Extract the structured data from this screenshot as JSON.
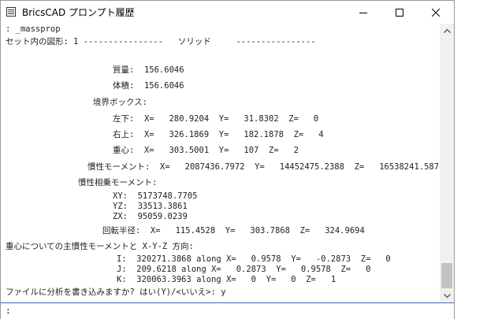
{
  "window": {
    "title": "BricsCAD プロンプト履歴"
  },
  "lines": [
    ": _massprop",
    "セット内の図形: 1 ----------------   ソリッド     ----------------",
    "質量:  156.6046",
    "体積:  156.6046",
    "境界ボックス:",
    "左下:  X=   280.9204  Y=   31.8302  Z=   0",
    "右上:  X=   326.1869  Y=   182.1878  Z=   4",
    "重心:  X=   303.5001  Y=   107  Z=   2",
    "慣性モーメント:  X=   2087436.7972  Y=   14452475.2388  Z=   16538241.587",
    "慣性相乗モーメント:",
    "XY:  5173748.7705",
    "YZ:  33513.3861",
    "ZX:  95059.0239",
    "回転半径:  X=   115.4528  Y=   303.7868  Z=   324.9694",
    "重心についての主慣性モーメントと X-Y-Z 方向:",
    "I:  320271.3868 along X=   0.9578  Y=   -0.2873  Z=   0",
    "J:  209.6218 along X=   0.2873  Y=   0.9578  Z=   0",
    "K:  320063.3963 along X=   0  Y=   0  Z=   1",
    "ファイルに分析を書き込みますか? はい(Y)/<いいえ>: y"
  ],
  "command": {
    "prompt": ":",
    "value": ""
  },
  "icons": {
    "app": "terminal-icon",
    "minimize": "minimize-icon",
    "maximize": "maximize-icon",
    "close": "close-icon"
  }
}
